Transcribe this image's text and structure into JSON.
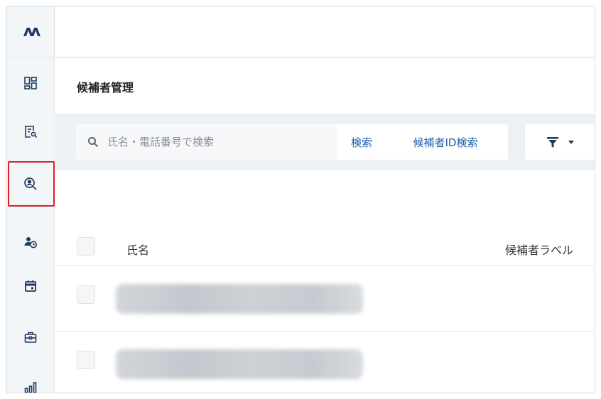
{
  "logo": {
    "text": "ʌʌ"
  },
  "sidebar": {
    "items": [
      {
        "name": "dashboard",
        "icon": "dashboard-icon"
      },
      {
        "name": "search-document",
        "icon": "document-search-icon"
      },
      {
        "name": "candidate-search",
        "icon": "person-search-icon",
        "active": true
      },
      {
        "name": "candidate-history",
        "icon": "person-clock-icon"
      },
      {
        "name": "calendar",
        "icon": "calendar-icon"
      },
      {
        "name": "jobs",
        "icon": "briefcase-icon"
      },
      {
        "name": "reports",
        "icon": "bar-chart-icon"
      }
    ]
  },
  "page": {
    "title": "候補者管理"
  },
  "search": {
    "placeholder": "氏名・電話番号で検索",
    "value": "",
    "button_label": "検索",
    "id_search_label": "候補者ID検索"
  },
  "filter": {
    "icon": "filter-icon",
    "dropdown_icon": "caret-down-icon"
  },
  "table": {
    "columns": [
      "氏名",
      "候補者ラベル"
    ],
    "rows": [
      {
        "name": ""
      },
      {
        "name": ""
      }
    ]
  },
  "colors": {
    "accent": "#1f5fa8",
    "sidebar_bg": "#f3f6f9",
    "search_bar_bg": "#eef1f4",
    "highlight": "#e02020",
    "icon": "#1e3a5f"
  }
}
